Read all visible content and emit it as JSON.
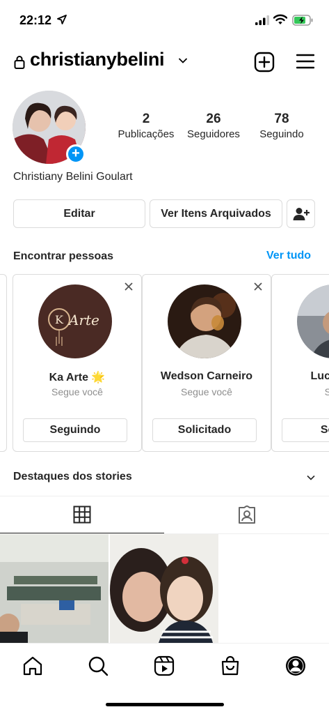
{
  "status_bar": {
    "time": "22:12"
  },
  "header": {
    "username": "christianybelini"
  },
  "profile": {
    "full_name": "Christiany Belini Goulart",
    "stats": [
      {
        "value": "2",
        "label": "Publicações"
      },
      {
        "value": "26",
        "label": "Seguidores"
      },
      {
        "value": "78",
        "label": "Seguindo"
      }
    ],
    "buttons": {
      "edit": "Editar",
      "archive": "Ver Itens Arquivados"
    }
  },
  "suggestions": {
    "title": "Encontrar pessoas",
    "see_all": "Ver tudo",
    "cards": [
      {
        "name": "Ka Arte 🌟",
        "subtitle": "Segue você",
        "button": "Seguindo",
        "avatar_text": "Arte"
      },
      {
        "name": "Wedson Carneiro",
        "subtitle": "Segue você",
        "button": "Solicitado"
      },
      {
        "name": "Lucas Ma",
        "subtitle": "Segu",
        "button": "Solic"
      }
    ]
  },
  "highlights": {
    "title": "Destaques dos stories"
  },
  "colors": {
    "accent": "#0095f6",
    "text": "#262626",
    "muted": "#8e8e8e",
    "border": "#dbdbdb"
  },
  "icons": [
    "location-arrow-icon",
    "signal-icon",
    "wifi-icon",
    "battery-icon",
    "lock-icon",
    "chevron-down-icon",
    "new-post-icon",
    "menu-icon",
    "add-person-icon",
    "close-icon",
    "grid-icon",
    "tagged-icon",
    "home-icon",
    "search-icon",
    "reels-icon",
    "shop-icon",
    "profile-icon"
  ]
}
